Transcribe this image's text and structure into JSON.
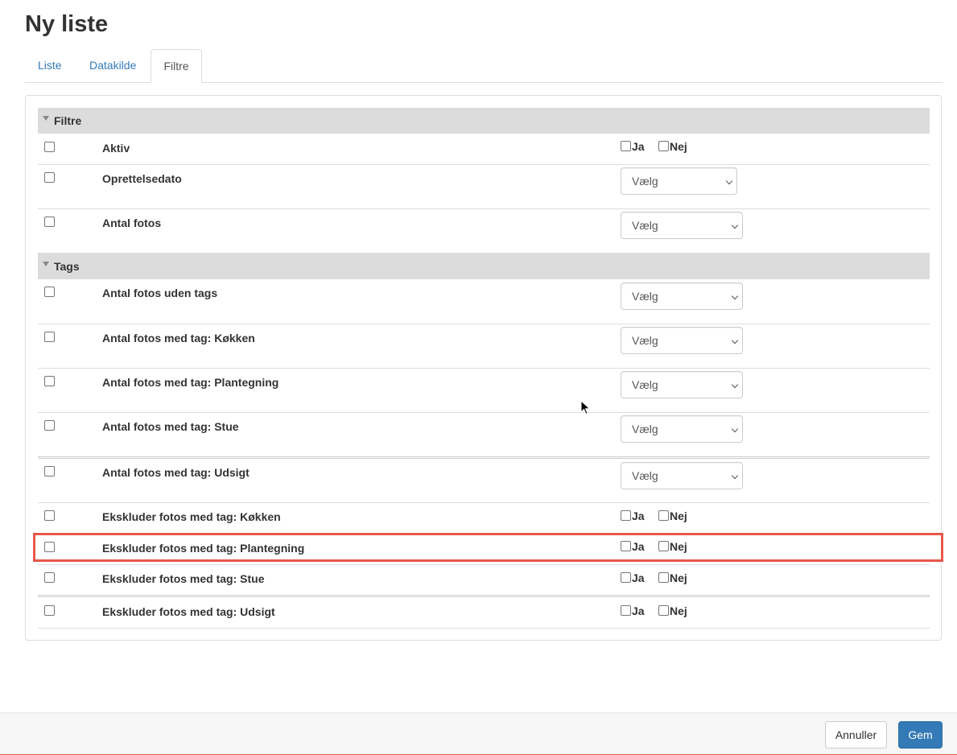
{
  "page": {
    "title": "Ny liste"
  },
  "tabs": [
    "Liste",
    "Datakilde",
    "Filtre"
  ],
  "sections": {
    "filters": "Filtre",
    "tags": "Tags"
  },
  "rows": [
    {
      "label": "Aktiv",
      "control": "yesno"
    },
    {
      "label": "Oprettelsedato",
      "control": "select"
    },
    {
      "label": "Antal fotos",
      "control": "select"
    },
    {
      "label": "Antal fotos uden tags",
      "control": "select"
    },
    {
      "label": "Antal fotos med tag: Køkken",
      "control": "select"
    },
    {
      "label": "Antal fotos med tag: Plantegning",
      "control": "select"
    },
    {
      "label": "Antal fotos med tag: Stue",
      "control": "select"
    },
    {
      "label": "Antal fotos med tag: Udsigt",
      "control": "select"
    },
    {
      "label": "Ekskluder fotos med tag: Køkken",
      "control": "yesno"
    },
    {
      "label": "Ekskluder fotos med tag: Plantegning",
      "control": "yesno"
    },
    {
      "label": "Ekskluder fotos med tag: Stue",
      "control": "yesno"
    },
    {
      "label": "Ekskluder fotos med tag: Udsigt",
      "control": "yesno"
    }
  ],
  "labels": {
    "yes": "Ja",
    "no": "Nej",
    "select_placeholder": "Vælg"
  },
  "footer": {
    "cancel": "Annuller",
    "save": "Gem"
  },
  "colors": {
    "primary": "#337ab7",
    "highlight": "#e8574c",
    "section_bg": "#dcdcdc"
  }
}
